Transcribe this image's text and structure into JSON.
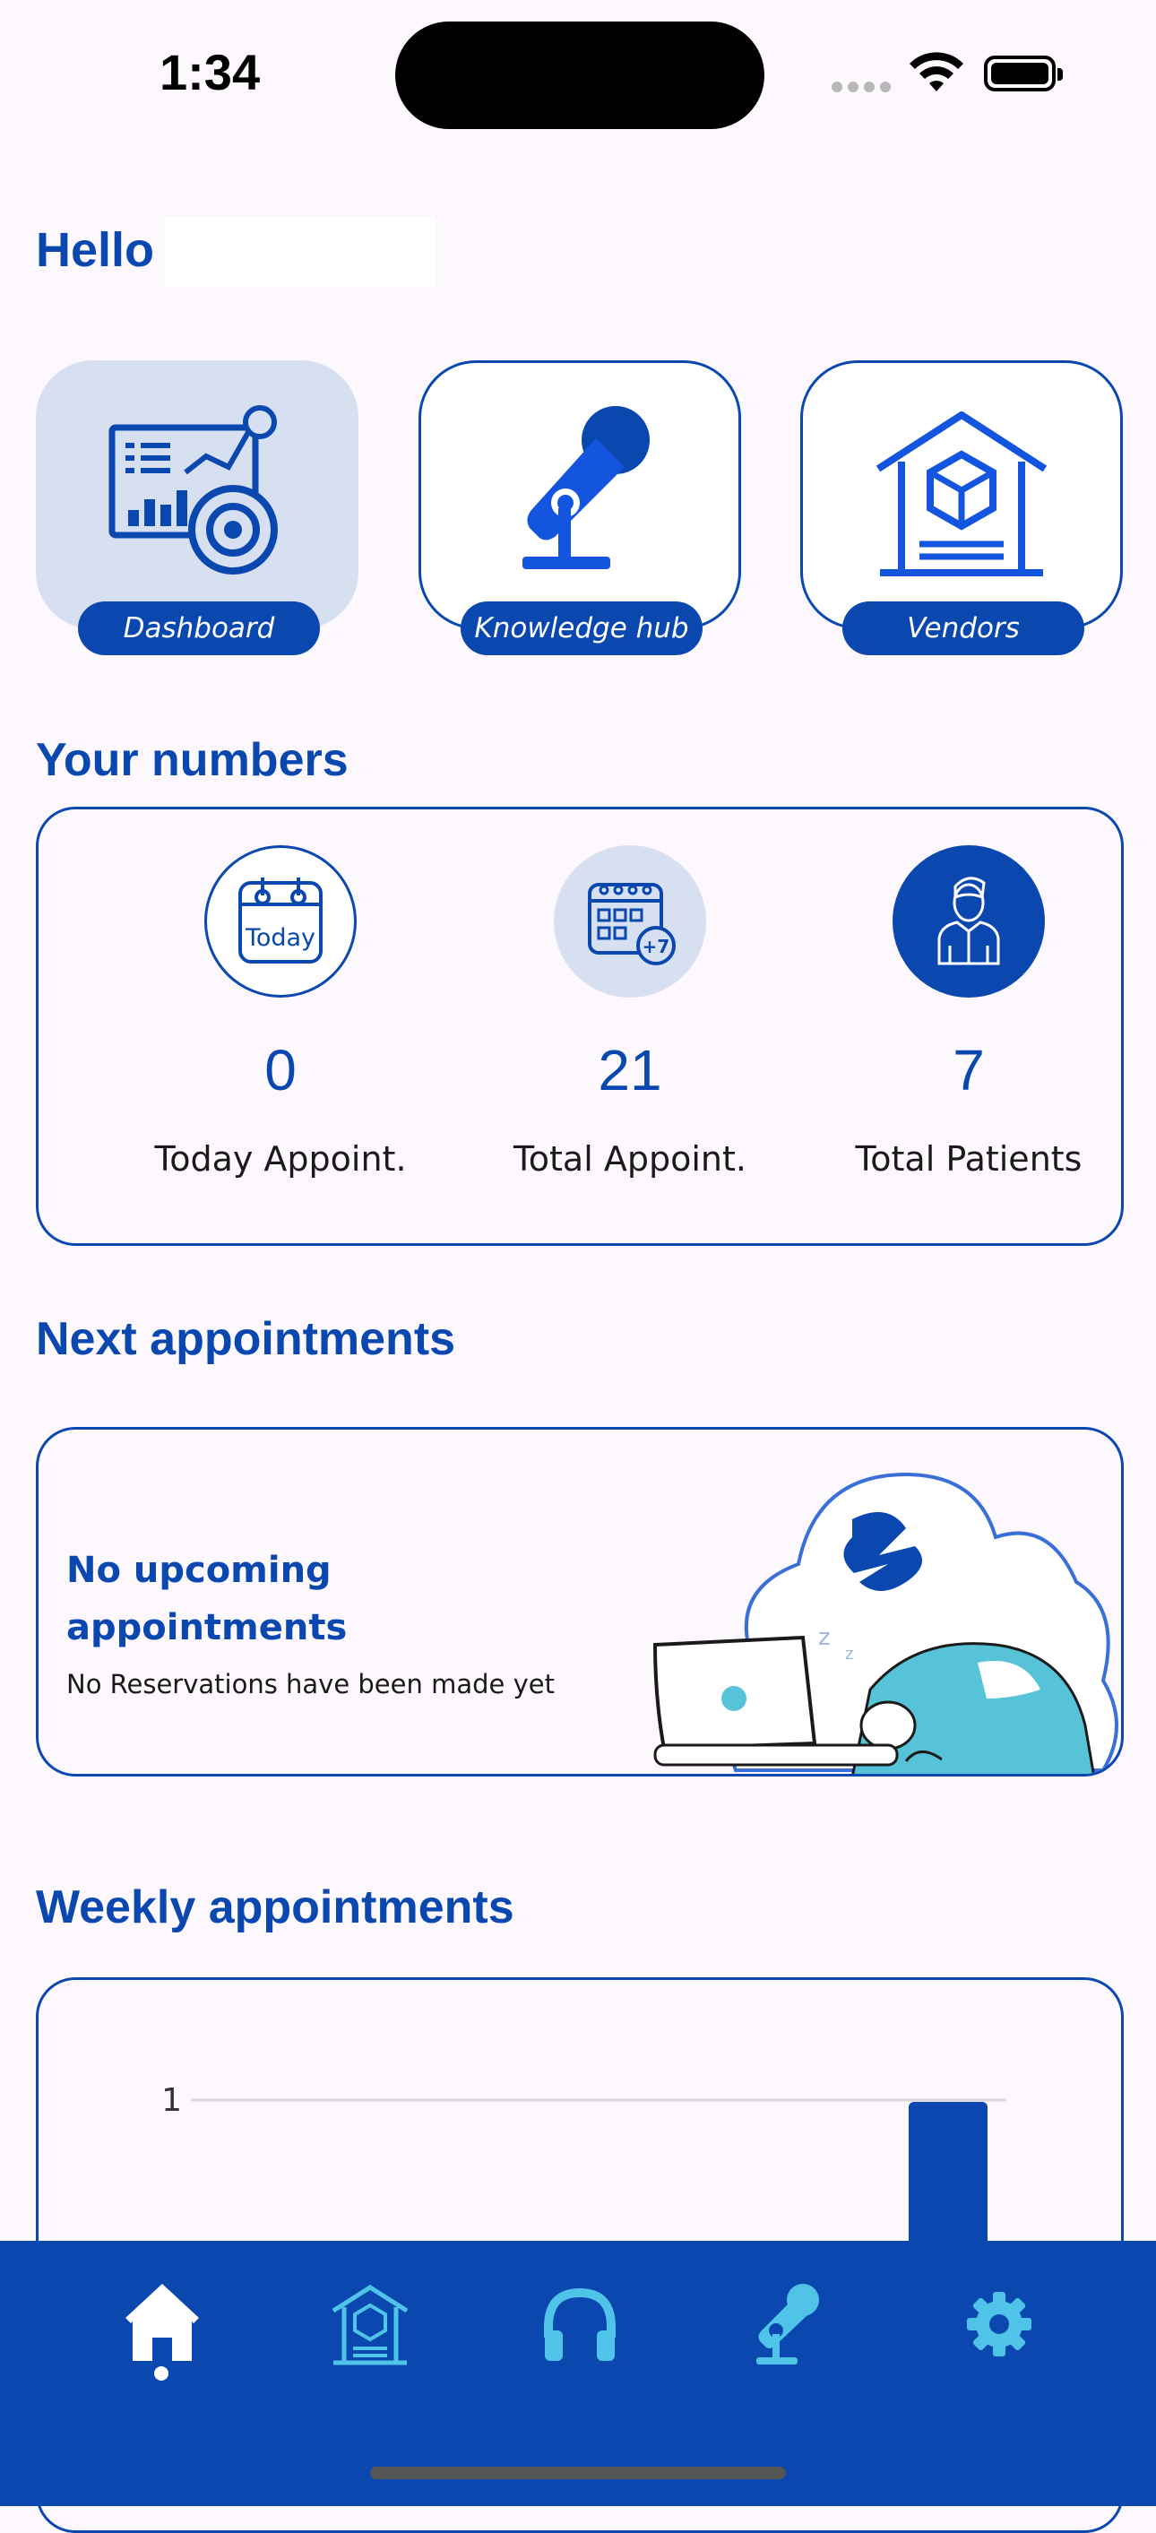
{
  "status_bar": {
    "time": "1:34"
  },
  "greeting": {
    "hello": "Hello"
  },
  "tiles": [
    {
      "label": "Dashboard",
      "icon": "dashboard-analytics-icon",
      "active": true
    },
    {
      "label": "Knowledge hub",
      "icon": "microphone-icon",
      "active": false
    },
    {
      "label": "Vendors",
      "icon": "vendors-house-icon",
      "active": false
    }
  ],
  "numbers": {
    "title": "Your numbers",
    "items": [
      {
        "icon": "calendar-today-icon",
        "icon_text": "Today",
        "value": "0",
        "label": "Today Appoint."
      },
      {
        "icon": "calendar-plus7-icon",
        "icon_text": "+7",
        "value": "21",
        "label": "Total Appoint."
      },
      {
        "icon": "patient-person-icon",
        "value": "7",
        "label": "Total Patients"
      }
    ]
  },
  "next_appointments": {
    "title": "Next appointments",
    "empty_title": "No upcoming appointments",
    "empty_subtitle": "No Reservations have been made yet"
  },
  "weekly": {
    "title": "Weekly appointments"
  },
  "chart_data": {
    "type": "bar",
    "y_tick_labels": [
      "1"
    ],
    "ylim": [
      0,
      1
    ],
    "grid": true,
    "values": [
      0,
      0,
      0,
      0,
      0,
      0,
      1
    ],
    "colors": {
      "bar": "#0a48b0",
      "grid": "#d9d9d9"
    }
  },
  "nav": [
    {
      "icon": "home-icon",
      "active": true
    },
    {
      "icon": "vendors-icon",
      "active": false
    },
    {
      "icon": "headphones-icon",
      "active": false
    },
    {
      "icon": "microphone-icon",
      "active": false
    },
    {
      "icon": "settings-gear-icon",
      "active": false
    }
  ],
  "colors": {
    "primary": "#0a48b0",
    "accent": "#4fc3e8",
    "tile_active": "#d7e0f1",
    "background": "#fdf8fd"
  }
}
